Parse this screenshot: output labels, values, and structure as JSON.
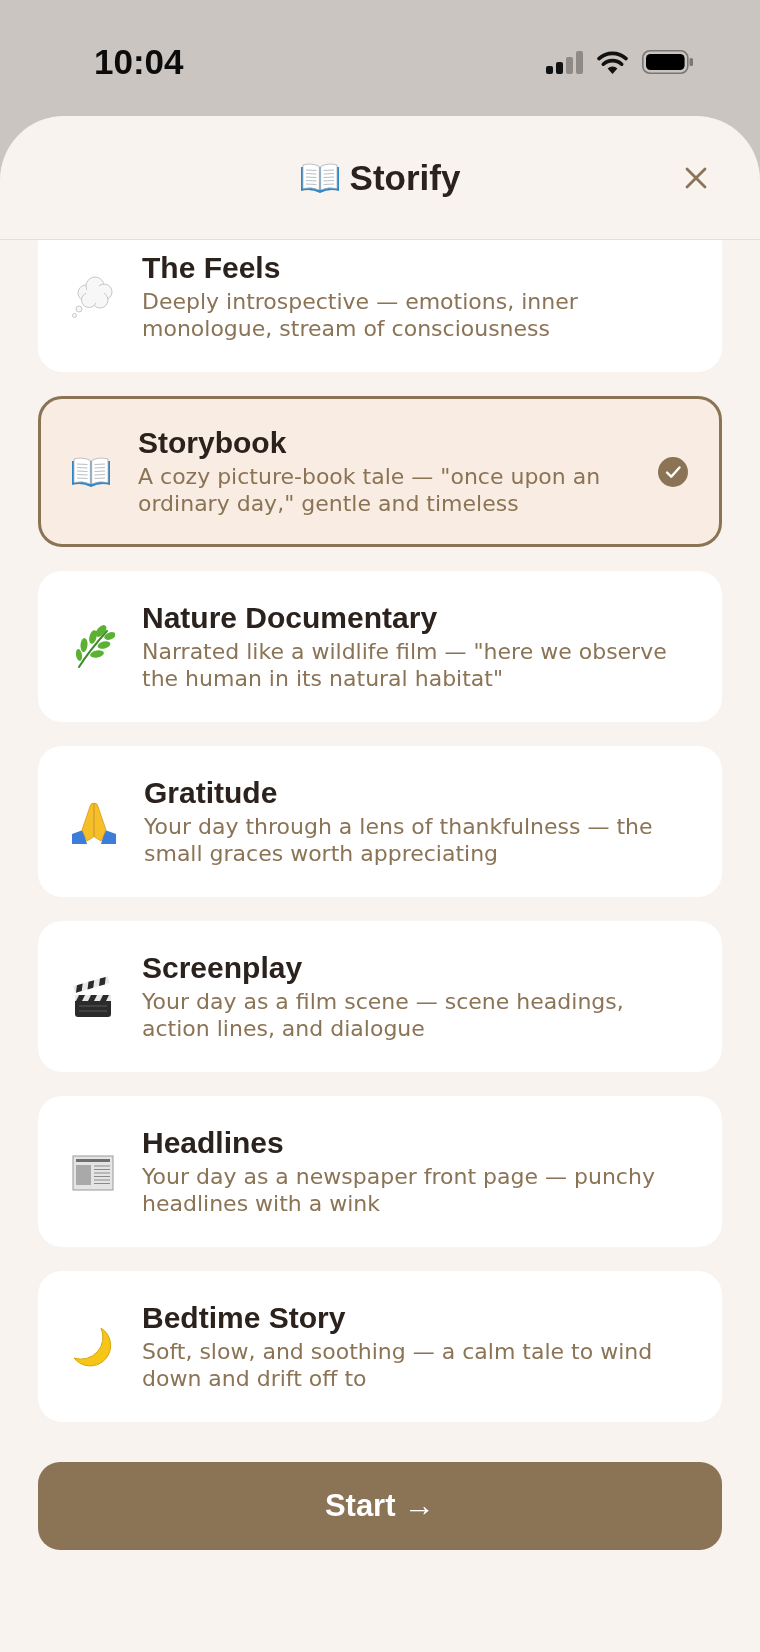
{
  "status_bar": {
    "time": "10:04"
  },
  "header": {
    "title": "Storify"
  },
  "options": [
    {
      "title": "The Feels",
      "description": "Deeply introspective — emotions, inner monologue, stream of consciousness",
      "selected": false
    },
    {
      "title": "Storybook",
      "description": "A cozy picture-book tale — \"once upon an ordinary day,\" gentle and timeless",
      "selected": true
    },
    {
      "title": "Nature Documentary",
      "description": "Narrated like a wildlife film — \"here we observe the human in its natural habitat\"",
      "selected": false
    },
    {
      "title": "Gratitude",
      "description": "Your day through a lens of thankfulness — the small graces worth appreciating",
      "selected": false
    },
    {
      "title": "Screenplay",
      "description": "Your day as a film scene — scene headings, action lines, and dialogue",
      "selected": false
    },
    {
      "title": "Headlines",
      "description": "Your day as a newspaper front page — punchy headlines with a wink",
      "selected": false
    },
    {
      "title": "Bedtime Story",
      "description": "Soft, slow, and soothing — a calm tale to wind down and drift off to",
      "selected": false
    }
  ],
  "start_button": {
    "label": "Start →"
  }
}
